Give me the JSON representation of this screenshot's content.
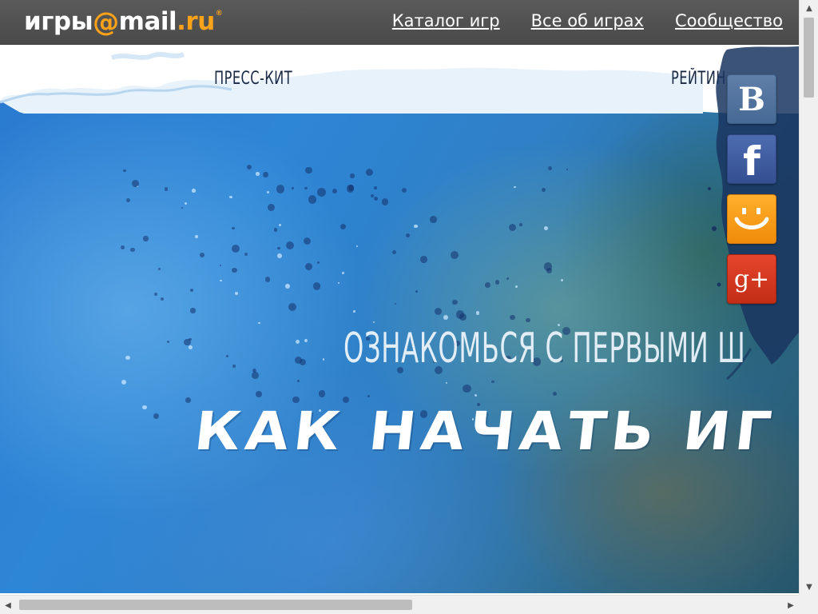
{
  "portal": {
    "logo": {
      "part_games": "игры",
      "part_at": "@",
      "part_mail": "mail",
      "part_dot_ru": ".ru",
      "reg_mark": "®"
    },
    "nav": [
      {
        "label": "Каталог игр"
      },
      {
        "label": "Все об играх"
      },
      {
        "label": "Сообщество"
      }
    ]
  },
  "sub_nav": [
    {
      "label": "ПРЕСС-КИТ"
    },
    {
      "label": "РЕЙТИН"
    }
  ],
  "hero": {
    "subtitle": "ОЗНАКОМЬСЯ С ПЕРВЫМИ Ш",
    "title": "КАК НАЧАТЬ ИГ"
  },
  "social": [
    {
      "network": "vkontakte",
      "glyph": "B",
      "icon": "vk-icon",
      "color": "#4f6f9c"
    },
    {
      "network": "facebook",
      "glyph": "f",
      "icon": "facebook-icon",
      "color": "#3b5998"
    },
    {
      "network": "moi-mir",
      "glyph": "smiley",
      "icon": "moimir-icon",
      "color": "#f5970d"
    },
    {
      "network": "google-plus",
      "glyph": "g+",
      "icon": "google-plus-icon",
      "color": "#d23a20"
    }
  ],
  "colors": {
    "portal_bar": "#4f4f4f",
    "logo_accent": "#f9a21a",
    "sub_nav_text": "#1b2a44",
    "hero_blue": "#2e86d6"
  },
  "scrollbars": {
    "vertical_arrow_up": "▲",
    "vertical_arrow_down": "▼",
    "horizontal_arrow_left": "◀",
    "horizontal_arrow_right": "▶"
  }
}
